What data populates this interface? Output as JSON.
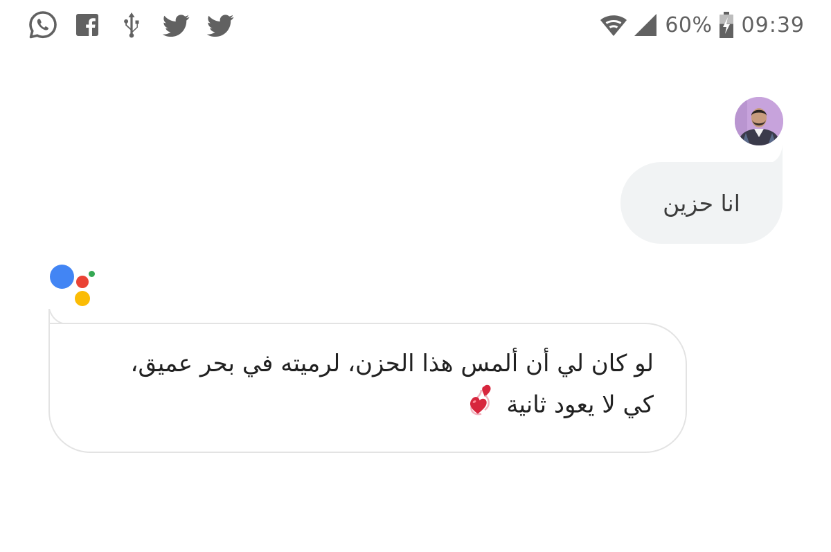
{
  "status_bar": {
    "notification_icons": [
      "whatsapp-icon",
      "facebook-icon",
      "usb-icon",
      "twitter-icon",
      "twitter-icon"
    ],
    "wifi_icon": "wifi-icon",
    "signal_icon": "cell-signal-icon",
    "battery_percent": "60%",
    "battery_icon": "battery-charging-icon",
    "battery_level": 0.6,
    "time": "09:39"
  },
  "conversation": {
    "user_message": "انا حزين",
    "assistant_message": "لو كان لي أن ألمس هذا الحزن، لرميته في بحر عميق، كي لا يعود ثانية",
    "assistant_emoji": "two-hearts-emoji"
  },
  "colors": {
    "status_icon": "#616161",
    "user_bubble_bg": "#f1f3f4",
    "assistant_border": "#e3e3e3",
    "google_blue": "#4285f4",
    "google_red": "#ea4335",
    "google_yellow": "#fbbc05",
    "google_green": "#34a853",
    "heart_red": "#d7263d"
  }
}
